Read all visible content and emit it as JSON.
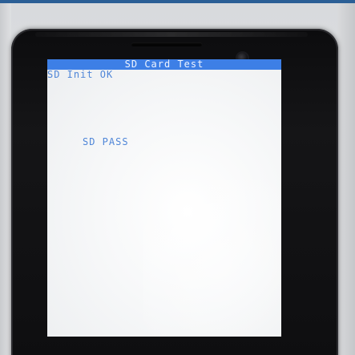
{
  "screen": {
    "title": "SD Card Test",
    "title_bar_color": "#3d7fe6",
    "text_color": "#4f86d8",
    "lines": [
      "SD Init OK",
      "SD PASS"
    ]
  }
}
